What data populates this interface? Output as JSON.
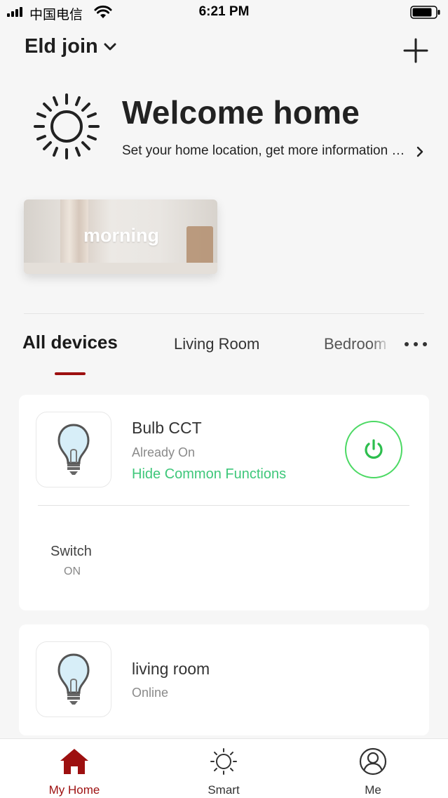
{
  "status_bar": {
    "carrier": "中国电信",
    "time": "6:21 PM"
  },
  "header": {
    "home_name": "Eld join",
    "chevron_icon": "chevron-down-icon",
    "add_icon": "plus-icon"
  },
  "welcome": {
    "icon": "sun-icon",
    "title": "Welcome home",
    "subtitle": "Set your home location, get more information about weather"
  },
  "scenes": [
    {
      "label": "morning"
    }
  ],
  "tabs": {
    "items": [
      {
        "label": "All devices",
        "active": true
      },
      {
        "label": "Living Room",
        "active": false
      },
      {
        "label": "Bedroom",
        "active": false
      }
    ],
    "more_icon": "ellipsis-icon"
  },
  "devices": [
    {
      "name": "Bulb CCT",
      "status": "Already On",
      "link": "Hide Common Functions",
      "icon": "light-bulb-icon",
      "power_icon": "power-icon",
      "functions": [
        {
          "label": "Switch",
          "value": "ON"
        }
      ]
    },
    {
      "name": "living room",
      "status": "Online",
      "icon": "light-bulb-icon"
    }
  ],
  "tab_bar": [
    {
      "label": "My Home",
      "icon": "house-icon",
      "active": true
    },
    {
      "label": "Smart",
      "icon": "sun-icon",
      "active": false
    },
    {
      "label": "Me",
      "icon": "user-icon",
      "active": false
    }
  ],
  "colors": {
    "accent": "#9d1010",
    "green": "#3ec77a",
    "power_ring": "#4cd964",
    "background": "#f6f6f6"
  }
}
